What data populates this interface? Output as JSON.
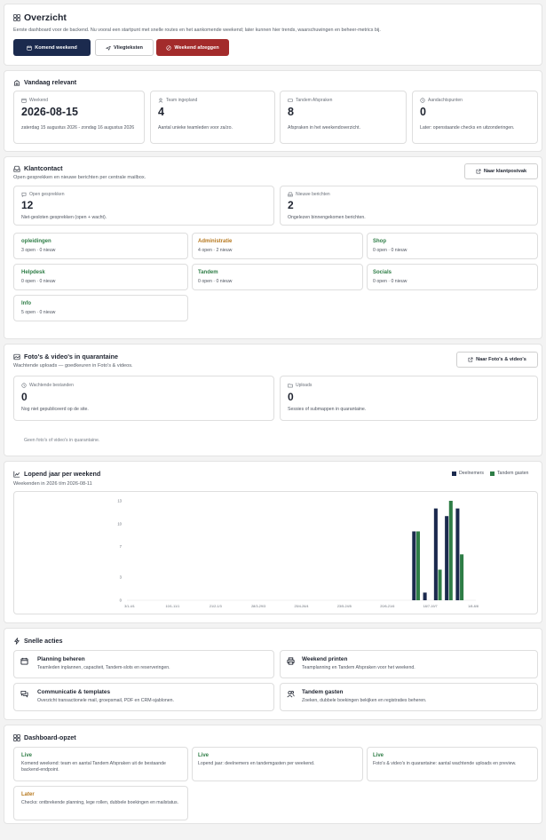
{
  "overview": {
    "title": "Overzicht",
    "subtitle": "Eerste dashboard voor de backend. Nu vooral een startpunt met snelle routes en het aankomende weekend; later kunnen hier trends, waarschuwingen en beheer-metrics bij.",
    "buttons": [
      "Komend weekend",
      "Vliegteksten",
      "Weekend afzeggen"
    ]
  },
  "today": {
    "title": "Vandaag relevant",
    "cards": [
      {
        "label": "Weekend",
        "value": "2026-08-15",
        "desc": "zaterdag 15 augustus 2026 - zondag 16 augustus 2026"
      },
      {
        "label": "Team ingepland",
        "value": "4",
        "desc": "Aantal unieke teamleden voor za/zo."
      },
      {
        "label": "Tandem Afspraken",
        "value": "8",
        "desc": "Afspraken in het weekendoverzicht."
      },
      {
        "label": "Aandachtspunten",
        "value": "0",
        "desc": "Later: openstaande checks en uitzonderingen."
      }
    ]
  },
  "customer": {
    "title": "Klantcontact",
    "subtitle": "Open gesprekken en nieuwe berichten per centrale mailbox.",
    "button": "Naar klantpostvak",
    "stats": [
      {
        "label": "Open gesprekken",
        "value": "12",
        "desc": "Niet-gesloten gesprekken (open + wacht)."
      },
      {
        "label": "Nieuwe berichten",
        "value": "2",
        "desc": "Ongelezen binnengekomen berichten."
      }
    ],
    "mailboxes": [
      {
        "name": "opleidingen",
        "stats": "3 open · 0 nieuw",
        "color": "#2e7d46"
      },
      {
        "name": "Administratie",
        "stats": "4 open · 2 nieuw",
        "color": "#b7791f"
      },
      {
        "name": "Shop",
        "stats": "0 open · 0 nieuw",
        "color": "#2e7d46"
      },
      {
        "name": "Helpdesk",
        "stats": "0 open · 0 nieuw",
        "color": "#2e7d46"
      },
      {
        "name": "Tandem",
        "stats": "0 open · 0 nieuw",
        "color": "#2e7d46"
      },
      {
        "name": "Socials",
        "stats": "0 open · 0 nieuw",
        "color": "#2e7d46"
      },
      {
        "name": "Info",
        "stats": "5 open · 0 nieuw",
        "color": "#2e7d46"
      }
    ]
  },
  "quarantine": {
    "title": "Foto's & video's in quarantaine",
    "subtitle": "Wachtende uploads — goedkeuren in Foto's & videos.",
    "button": "Naar Foto's & video's",
    "stats": [
      {
        "label": "Wachtende bestanden",
        "value": "0",
        "desc": "Nog niet gepubliceerd op de site."
      },
      {
        "label": "Uploads",
        "value": "0",
        "desc": "Sessies of submappen in quarantaine."
      }
    ],
    "empty": "Geen foto's of video's in quarantaine."
  },
  "yearchart": {
    "title": "Lopend jaar per weekend",
    "subtitle": "Weekenden in 2026 t/m 2026-08-11"
  },
  "chart_data": {
    "type": "bar",
    "categories": [
      "3/1-4/1",
      "10/1-11/1",
      "17/1-18/1",
      "24/1-25/1",
      "31/1-1/2",
      "7/2-8/2",
      "14/2-15/2",
      "21/2-22/2",
      "28/2-1/3",
      "7/3-8/3",
      "14/3-15/3",
      "21/3-22/3",
      "28/3-29/3",
      "4/4-5/4",
      "11/4-12/4",
      "18/4-19/4",
      "25/4-26/4",
      "2/5-3/5",
      "9/5-10/5",
      "16/5-17/5",
      "23/5-24/5",
      "30/5-31/5",
      "6/6-7/6",
      "13/6-14/6",
      "20/6-21/6",
      "27/6-28/6",
      "4/7-5/7",
      "11/7-12/7",
      "18/7-19/7",
      "25/7-26/7",
      "1/8-2/8",
      "8/8-9/8"
    ],
    "tick_labels": [
      "3/1-4/1",
      "10/1-11/1",
      "21/2-1/3",
      "28/3-29/3",
      "25/4-26/4",
      "23/5-24/5",
      "20/6-21/6",
      "18/7-19/7",
      "1/8-8/8"
    ],
    "series": [
      {
        "name": "Deelnemers",
        "color": "#1b2a4e",
        "values": [
          0,
          0,
          0,
          0,
          0,
          0,
          0,
          0,
          0,
          0,
          0,
          0,
          0,
          0,
          0,
          0,
          0,
          0,
          0,
          0,
          0,
          0,
          0,
          0,
          0,
          0,
          9,
          1,
          12,
          11,
          12,
          0
        ]
      },
      {
        "name": "Tandem gasten",
        "color": "#2e7d46",
        "values": [
          0,
          0,
          0,
          0,
          0,
          0,
          0,
          0,
          0,
          0,
          0,
          0,
          0,
          0,
          0,
          0,
          0,
          0,
          0,
          0,
          0,
          0,
          0,
          0,
          0,
          0,
          9,
          0,
          4,
          13,
          6,
          0
        ]
      }
    ],
    "yticks": [
      0,
      3,
      7,
      10,
      13
    ],
    "ylim": [
      0,
      13
    ],
    "legend_position": "top-right",
    "grid": false
  },
  "quick": {
    "title": "Snelle acties",
    "items": [
      {
        "title": "Planning beheren",
        "desc": "Teamleden inplannen, capaciteit, Tandem-slots en reserveringen.",
        "icon": "calendar-icon"
      },
      {
        "title": "Weekend printen",
        "desc": "Teamplanning en Tandem Afspraken voor het weekend.",
        "icon": "printer-icon"
      },
      {
        "title": "Communicatie & templates",
        "desc": "Overzicht transactionele mail, groepsmail, PDF en CRM-sjablonen.",
        "icon": "chat-icon"
      },
      {
        "title": "Tandem gasten",
        "desc": "Zoeken, dubbele boekingen bekijken en registraties beheren.",
        "icon": "users-icon"
      }
    ]
  },
  "setup": {
    "title": "Dashboard-opzet",
    "items": [
      {
        "status": "Live",
        "desc": "Komend weekend: team en aantal Tandem Afspraken uit de bestaande backend-endpoint.",
        "color": "#2e7d46"
      },
      {
        "status": "Live",
        "desc": "Lopend jaar: deelnemers en tandemgasten per weekend.",
        "color": "#2e7d46"
      },
      {
        "status": "Live",
        "desc": "Foto's & video's in quarantaine: aantal wachtende uploads en preview.",
        "color": "#2e7d46"
      },
      {
        "status": "Later",
        "desc": "Checks: ontbrekende planning, lege rollen, dubbele boekingen en mailstatus.",
        "color": "#b7791f"
      }
    ]
  },
  "colors": {
    "primary": "#1b2a4e",
    "danger": "#a32b2b",
    "green": "#2e7d46",
    "amber": "#b7791f"
  }
}
